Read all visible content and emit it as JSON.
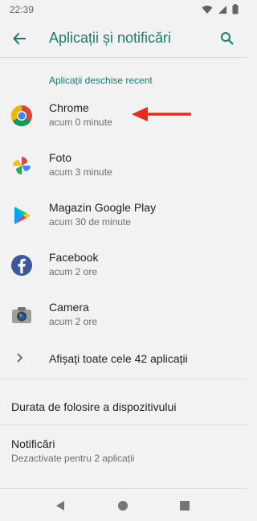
{
  "status_bar": {
    "time": "22:39"
  },
  "header": {
    "title": "Aplicații și notificări"
  },
  "recent": {
    "section_title": "Aplicații deschise recent",
    "apps": [
      {
        "name": "Chrome",
        "last_used": "acum 0 minute",
        "icon": "chrome-icon"
      },
      {
        "name": "Foto",
        "last_used": "acum 3 minute",
        "icon": "photos-icon"
      },
      {
        "name": "Magazin Google Play",
        "last_used": "acum 30 de minute",
        "icon": "play-store-icon"
      },
      {
        "name": "Facebook",
        "last_used": "acum 2 ore",
        "icon": "facebook-icon"
      },
      {
        "name": "Camera",
        "last_used": "acum 2 ore",
        "icon": "camera-icon"
      }
    ],
    "show_all_label": "Afișați toate cele 42 aplicații"
  },
  "settings": {
    "screen_time": {
      "title": "Durata de folosire a dispozitivului"
    },
    "notifications": {
      "title": "Notificări",
      "subtitle": "Dezactivate pentru 2 aplicații"
    }
  },
  "colors": {
    "accent": "#1a7a6e",
    "background": "#f2f2f2",
    "annotation_arrow": "#e8291c"
  }
}
